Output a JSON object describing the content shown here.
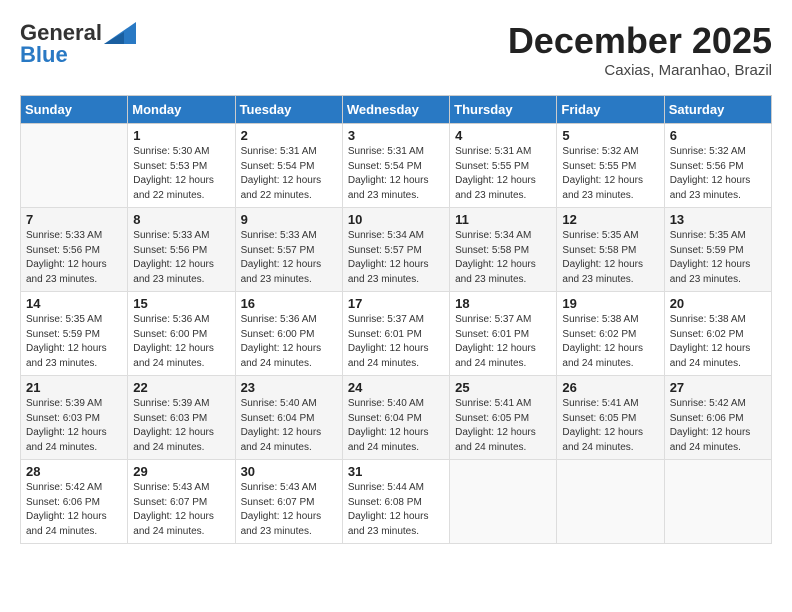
{
  "header": {
    "logo_general": "General",
    "logo_blue": "Blue",
    "month_title": "December 2025",
    "subtitle": "Caxias, Maranhao, Brazil"
  },
  "weekdays": [
    "Sunday",
    "Monday",
    "Tuesday",
    "Wednesday",
    "Thursday",
    "Friday",
    "Saturday"
  ],
  "weeks": [
    [
      {
        "day": "",
        "sunrise": "",
        "sunset": "",
        "daylight": ""
      },
      {
        "day": "1",
        "sunrise": "Sunrise: 5:30 AM",
        "sunset": "Sunset: 5:53 PM",
        "daylight": "Daylight: 12 hours and 22 minutes."
      },
      {
        "day": "2",
        "sunrise": "Sunrise: 5:31 AM",
        "sunset": "Sunset: 5:54 PM",
        "daylight": "Daylight: 12 hours and 22 minutes."
      },
      {
        "day": "3",
        "sunrise": "Sunrise: 5:31 AM",
        "sunset": "Sunset: 5:54 PM",
        "daylight": "Daylight: 12 hours and 23 minutes."
      },
      {
        "day": "4",
        "sunrise": "Sunrise: 5:31 AM",
        "sunset": "Sunset: 5:55 PM",
        "daylight": "Daylight: 12 hours and 23 minutes."
      },
      {
        "day": "5",
        "sunrise": "Sunrise: 5:32 AM",
        "sunset": "Sunset: 5:55 PM",
        "daylight": "Daylight: 12 hours and 23 minutes."
      },
      {
        "day": "6",
        "sunrise": "Sunrise: 5:32 AM",
        "sunset": "Sunset: 5:56 PM",
        "daylight": "Daylight: 12 hours and 23 minutes."
      }
    ],
    [
      {
        "day": "7",
        "sunrise": "Sunrise: 5:33 AM",
        "sunset": "Sunset: 5:56 PM",
        "daylight": "Daylight: 12 hours and 23 minutes."
      },
      {
        "day": "8",
        "sunrise": "Sunrise: 5:33 AM",
        "sunset": "Sunset: 5:56 PM",
        "daylight": "Daylight: 12 hours and 23 minutes."
      },
      {
        "day": "9",
        "sunrise": "Sunrise: 5:33 AM",
        "sunset": "Sunset: 5:57 PM",
        "daylight": "Daylight: 12 hours and 23 minutes."
      },
      {
        "day": "10",
        "sunrise": "Sunrise: 5:34 AM",
        "sunset": "Sunset: 5:57 PM",
        "daylight": "Daylight: 12 hours and 23 minutes."
      },
      {
        "day": "11",
        "sunrise": "Sunrise: 5:34 AM",
        "sunset": "Sunset: 5:58 PM",
        "daylight": "Daylight: 12 hours and 23 minutes."
      },
      {
        "day": "12",
        "sunrise": "Sunrise: 5:35 AM",
        "sunset": "Sunset: 5:58 PM",
        "daylight": "Daylight: 12 hours and 23 minutes."
      },
      {
        "day": "13",
        "sunrise": "Sunrise: 5:35 AM",
        "sunset": "Sunset: 5:59 PM",
        "daylight": "Daylight: 12 hours and 23 minutes."
      }
    ],
    [
      {
        "day": "14",
        "sunrise": "Sunrise: 5:35 AM",
        "sunset": "Sunset: 5:59 PM",
        "daylight": "Daylight: 12 hours and 23 minutes."
      },
      {
        "day": "15",
        "sunrise": "Sunrise: 5:36 AM",
        "sunset": "Sunset: 6:00 PM",
        "daylight": "Daylight: 12 hours and 24 minutes."
      },
      {
        "day": "16",
        "sunrise": "Sunrise: 5:36 AM",
        "sunset": "Sunset: 6:00 PM",
        "daylight": "Daylight: 12 hours and 24 minutes."
      },
      {
        "day": "17",
        "sunrise": "Sunrise: 5:37 AM",
        "sunset": "Sunset: 6:01 PM",
        "daylight": "Daylight: 12 hours and 24 minutes."
      },
      {
        "day": "18",
        "sunrise": "Sunrise: 5:37 AM",
        "sunset": "Sunset: 6:01 PM",
        "daylight": "Daylight: 12 hours and 24 minutes."
      },
      {
        "day": "19",
        "sunrise": "Sunrise: 5:38 AM",
        "sunset": "Sunset: 6:02 PM",
        "daylight": "Daylight: 12 hours and 24 minutes."
      },
      {
        "day": "20",
        "sunrise": "Sunrise: 5:38 AM",
        "sunset": "Sunset: 6:02 PM",
        "daylight": "Daylight: 12 hours and 24 minutes."
      }
    ],
    [
      {
        "day": "21",
        "sunrise": "Sunrise: 5:39 AM",
        "sunset": "Sunset: 6:03 PM",
        "daylight": "Daylight: 12 hours and 24 minutes."
      },
      {
        "day": "22",
        "sunrise": "Sunrise: 5:39 AM",
        "sunset": "Sunset: 6:03 PM",
        "daylight": "Daylight: 12 hours and 24 minutes."
      },
      {
        "day": "23",
        "sunrise": "Sunrise: 5:40 AM",
        "sunset": "Sunset: 6:04 PM",
        "daylight": "Daylight: 12 hours and 24 minutes."
      },
      {
        "day": "24",
        "sunrise": "Sunrise: 5:40 AM",
        "sunset": "Sunset: 6:04 PM",
        "daylight": "Daylight: 12 hours and 24 minutes."
      },
      {
        "day": "25",
        "sunrise": "Sunrise: 5:41 AM",
        "sunset": "Sunset: 6:05 PM",
        "daylight": "Daylight: 12 hours and 24 minutes."
      },
      {
        "day": "26",
        "sunrise": "Sunrise: 5:41 AM",
        "sunset": "Sunset: 6:05 PM",
        "daylight": "Daylight: 12 hours and 24 minutes."
      },
      {
        "day": "27",
        "sunrise": "Sunrise: 5:42 AM",
        "sunset": "Sunset: 6:06 PM",
        "daylight": "Daylight: 12 hours and 24 minutes."
      }
    ],
    [
      {
        "day": "28",
        "sunrise": "Sunrise: 5:42 AM",
        "sunset": "Sunset: 6:06 PM",
        "daylight": "Daylight: 12 hours and 24 minutes."
      },
      {
        "day": "29",
        "sunrise": "Sunrise: 5:43 AM",
        "sunset": "Sunset: 6:07 PM",
        "daylight": "Daylight: 12 hours and 24 minutes."
      },
      {
        "day": "30",
        "sunrise": "Sunrise: 5:43 AM",
        "sunset": "Sunset: 6:07 PM",
        "daylight": "Daylight: 12 hours and 23 minutes."
      },
      {
        "day": "31",
        "sunrise": "Sunrise: 5:44 AM",
        "sunset": "Sunset: 6:08 PM",
        "daylight": "Daylight: 12 hours and 23 minutes."
      },
      {
        "day": "",
        "sunrise": "",
        "sunset": "",
        "daylight": ""
      },
      {
        "day": "",
        "sunrise": "",
        "sunset": "",
        "daylight": ""
      },
      {
        "day": "",
        "sunrise": "",
        "sunset": "",
        "daylight": ""
      }
    ]
  ]
}
